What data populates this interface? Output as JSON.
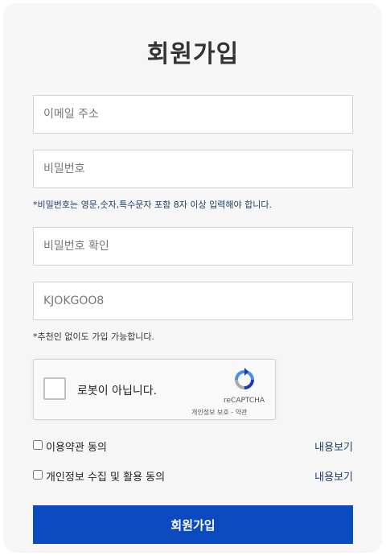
{
  "title": "회원가입",
  "fields": {
    "email_placeholder": "이메일 주소",
    "password_placeholder": "비밀번호",
    "password_hint": "*비밀번호는 영문,숫자,특수문자 포함 8자 이상 입력해야 합니다.",
    "password_confirm_placeholder": "비밀번호 확인",
    "referral_placeholder": "KJOKGOO8",
    "referral_hint": "*추천인 없이도 가입 가능합니다."
  },
  "captcha": {
    "label": "로봇이 아닙니다.",
    "brand": "reCAPTCHA",
    "links": "개인정보 보호 - 약관"
  },
  "agreements": {
    "terms_label": "이용약관 동의",
    "terms_view": "내용보기",
    "privacy_label": "개인정보 수집 및 활용 동의",
    "privacy_view": "내용보기"
  },
  "submit_label": "회원가입",
  "colors": {
    "primary": "#0b4bbf",
    "link": "#1f3f66",
    "background": "#f6f6f6"
  }
}
